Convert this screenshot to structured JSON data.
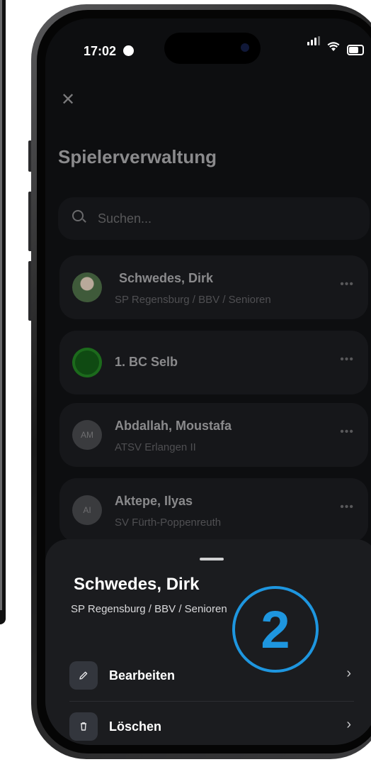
{
  "status_bar": {
    "time": "17:02"
  },
  "page": {
    "title": "Spielerverwaltung",
    "close_icon": "close-icon",
    "search": {
      "placeholder": "Suchen..."
    }
  },
  "players": [
    {
      "name": "Schwedes, Dirk",
      "club": "SP Regensburg / BBV / Senioren",
      "avatar": "photo"
    },
    {
      "name": "1. BC Selb",
      "club": "",
      "avatar": "club-logo"
    },
    {
      "name": "Abdallah, Moustafa",
      "club": "ATSV Erlangen II",
      "initials": "AM"
    },
    {
      "name": "Aktepe, Ilyas",
      "club": "SV Fürth-Poppenreuth",
      "initials": "AI"
    }
  ],
  "sheet": {
    "name": "Schwedes, Dirk",
    "subtitle": "SP Regensburg / BBV / Senioren",
    "actions": [
      {
        "label": "Bearbeiten",
        "icon": "pencil-icon"
      },
      {
        "label": "Löschen",
        "icon": "trash-icon"
      }
    ]
  },
  "step_badge": "2",
  "colors": {
    "background": "#0d0e10",
    "sheet": "#1b1c1f",
    "accent": "#1e96df"
  }
}
